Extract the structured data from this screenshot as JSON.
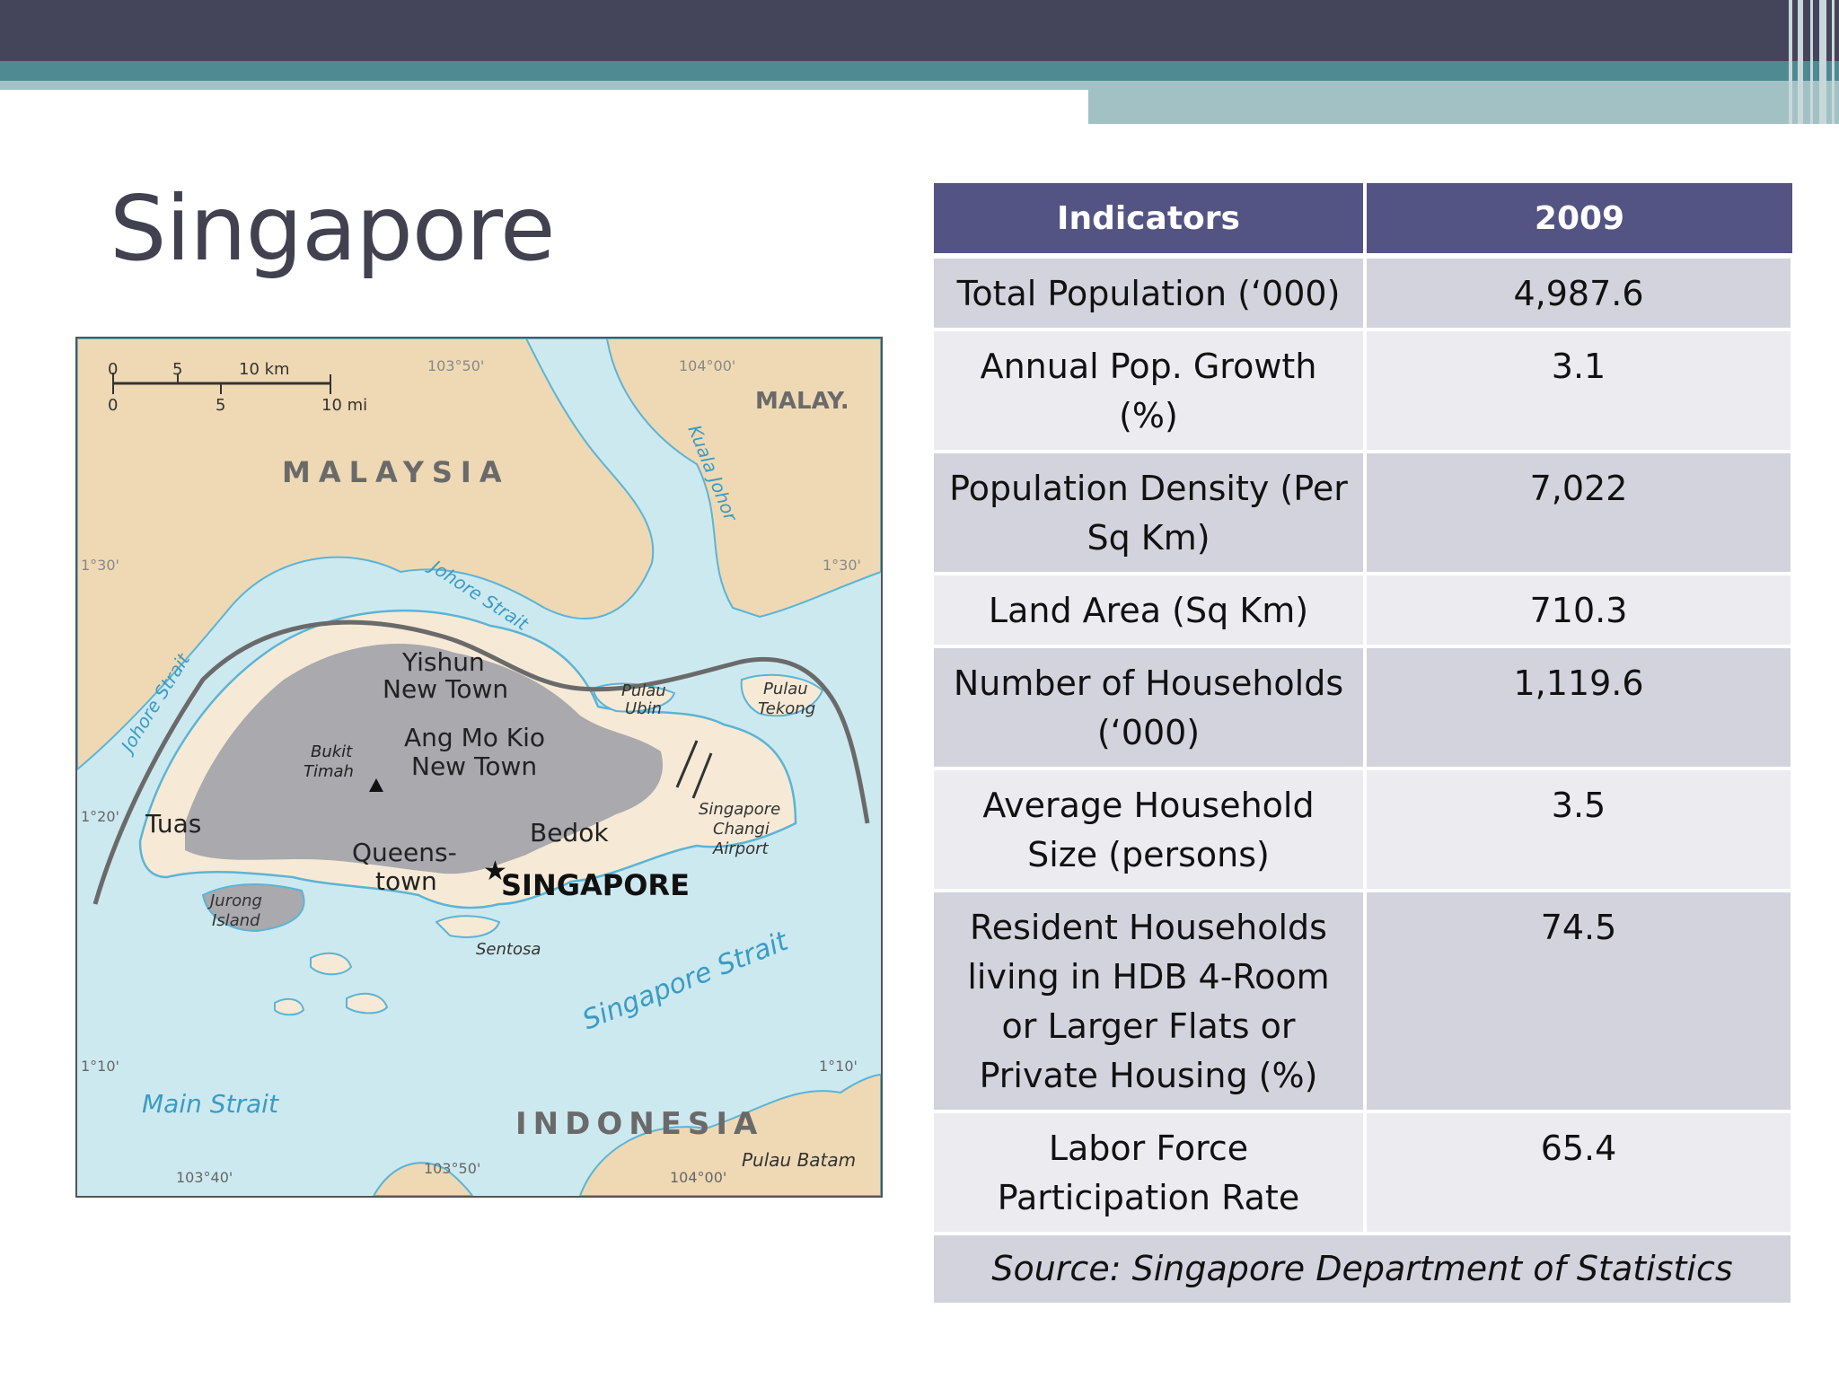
{
  "slide": {
    "title": "Singapore"
  },
  "map": {
    "scale": {
      "km0": "0",
      "km5": "5",
      "km10": "10 km",
      "mi0": "0",
      "mi5": "5",
      "mi10": "10 mi"
    },
    "lon_labels": {
      "a": "103°50'",
      "b": "104°00'",
      "c": "103°40'",
      "d": "103°50'",
      "e": "104°00'"
    },
    "lat_labels": {
      "l1": "1°30'",
      "r1": "1°30'",
      "l2": "1°20'",
      "l3": "1°10'",
      "r3": "1°10'"
    },
    "countries": {
      "malaysia": "MALAYSIA",
      "malay_abbr": "MALAY.",
      "indonesia": "INDONESIA"
    },
    "water": {
      "johore_strait_top": "Johore Strait",
      "johore_strait_left": "Johore Strait",
      "kuala_johor": "Kuala Johor",
      "singapore_strait": "Singapore Strait",
      "main_strait": "Main Strait"
    },
    "places": {
      "yishun_1": "Yishun",
      "yishun_2": "New Town",
      "amk_1": "Ang Mo Kio",
      "amk_2": "New Town",
      "bukit_1": "Bukit",
      "bukit_2": "Timah",
      "tuas": "Tuas",
      "queens_1": "Queens-",
      "queens_2": "town",
      "bedok": "Bedok",
      "singapore": "SINGAPORE",
      "jurong_1": "Jurong",
      "jurong_2": "Island",
      "sentosa": "Sentosa",
      "ubin_1": "Pulau",
      "ubin_2": "Ubin",
      "tekong_1": "Pulau",
      "tekong_2": "Tekong",
      "changi_1": "Singapore",
      "changi_2": "Changi",
      "changi_3": "Airport",
      "batam": "Pulau Batam"
    },
    "colors": {
      "water": "#cde9f0",
      "land_foreign": "#efd9b4",
      "land_sg": "#f6ead6",
      "urban": "#a9a9ae",
      "coast": "#5cb4d4"
    }
  },
  "table": {
    "headers": [
      "Indicators",
      "2009"
    ],
    "rows": [
      {
        "indicator": "Total Population (‘000)",
        "value": "4,987.6"
      },
      {
        "indicator": "Annual Pop. Growth (%)",
        "value": "3.1"
      },
      {
        "indicator": "Population Density (Per Sq Km)",
        "value": "7,022"
      },
      {
        "indicator": "Land Area (Sq Km)",
        "value": "710.3"
      },
      {
        "indicator": "Number of Households (‘000)",
        "value": "1,119.6"
      },
      {
        "indicator": "Average Household Size (persons)",
        "value": "3.5"
      },
      {
        "indicator": "Resident Households living in HDB 4-Room or Larger Flats or Private Housing (%)",
        "value": "74.5"
      },
      {
        "indicator": "Labor Force Participation Rate",
        "value": "65.4"
      }
    ],
    "source": "Source: Singapore Department of Statistics"
  }
}
